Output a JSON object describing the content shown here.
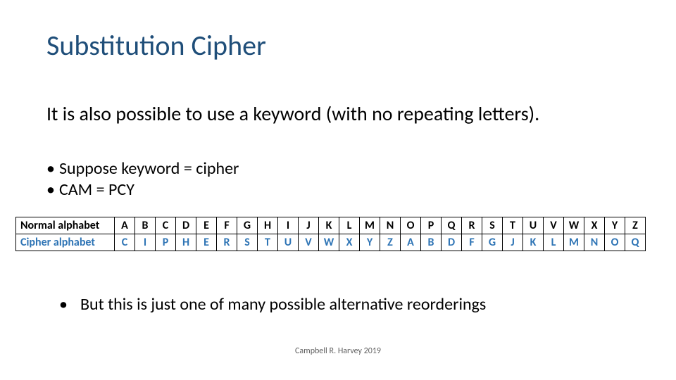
{
  "title": "Substitution Cipher",
  "subtitle": "It is also possible to use a keyword (with no repeating letters).",
  "bullets": [
    "Suppose keyword = cipher",
    "CAM = PCY"
  ],
  "chart_data": {
    "type": "table",
    "rows": [
      {
        "label": "Normal alphabet",
        "cells": [
          "A",
          "B",
          "C",
          "D",
          "E",
          "F",
          "G",
          "H",
          "I",
          "J",
          "K",
          "L",
          "M",
          "N",
          "O",
          "P",
          "Q",
          "R",
          "S",
          "T",
          "U",
          "V",
          "W",
          "X",
          "Y",
          "Z"
        ]
      },
      {
        "label": "Cipher alphabet",
        "cells": [
          "C",
          "I",
          "P",
          "H",
          "E",
          "R",
          "S",
          "T",
          "U",
          "V",
          "W",
          "X",
          "Y",
          "Z",
          "A",
          "B",
          "D",
          "F",
          "G",
          "J",
          "K",
          "L",
          "M",
          "N",
          "O",
          "Q"
        ]
      }
    ]
  },
  "bottom_bullet": "But this is just one of many possible alternative reorderings",
  "footer": "Campbell R. Harvey 2019"
}
